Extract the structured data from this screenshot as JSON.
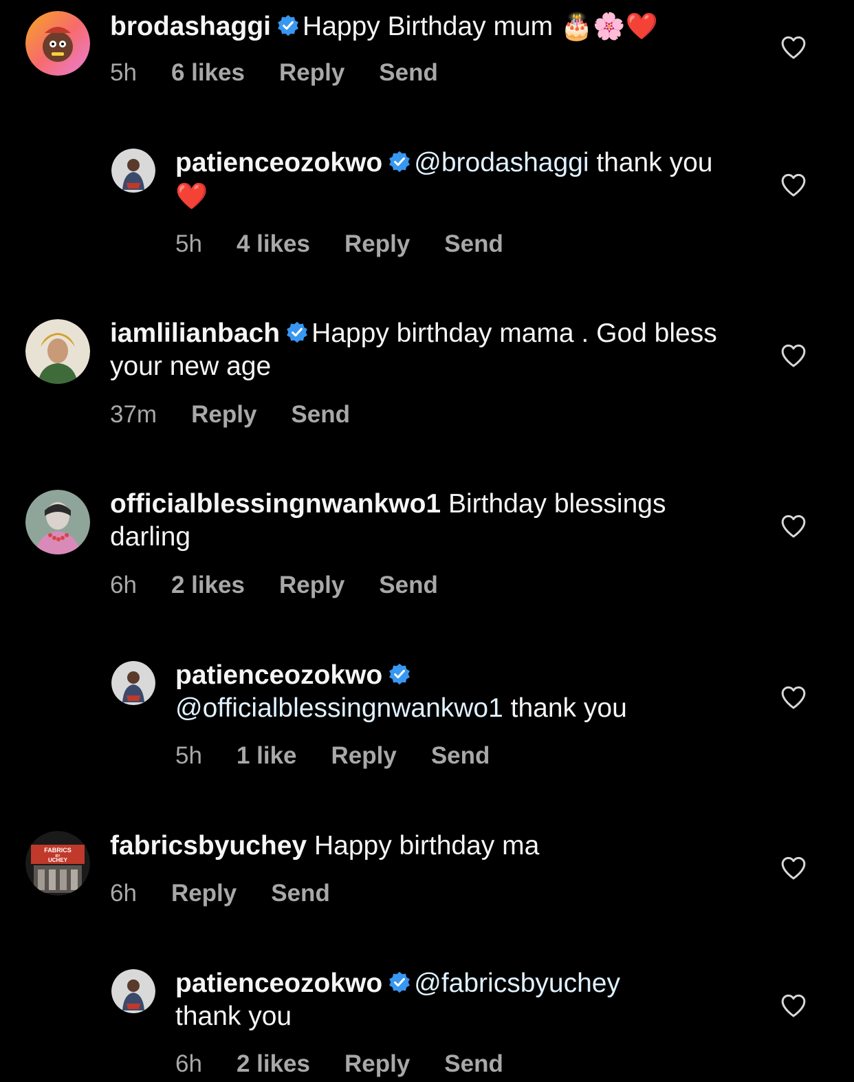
{
  "comments": [
    {
      "username": "brodashaggi",
      "verified": true,
      "text": "Happy Birthday mum",
      "emojis": [
        "🎂",
        "🌸",
        "❤️"
      ],
      "time": "5h",
      "likes": "6 likes",
      "reply": "Reply",
      "send": "Send"
    },
    {
      "username": "patienceozokwo",
      "verified": true,
      "mention": "@brodashaggi",
      "text": "thank you",
      "emojis": [
        "❤️"
      ],
      "time": "5h",
      "likes": "4 likes",
      "reply": "Reply",
      "send": "Send"
    },
    {
      "username": "iamlilianbach",
      "verified": true,
      "text": "Happy birthday mama . God bless your new age",
      "time": "37m",
      "reply": "Reply",
      "send": "Send"
    },
    {
      "username": "officialblessingnwankwo1",
      "verified": false,
      "text": "Birthday blessings darling",
      "time": "6h",
      "likes": "2 likes",
      "reply": "Reply",
      "send": "Send"
    },
    {
      "username": "patienceozokwo",
      "verified": true,
      "mention": "@officialblessingnwankwo1",
      "text": "thank you",
      "time": "5h",
      "likes": "1 like",
      "reply": "Reply",
      "send": "Send"
    },
    {
      "username": "fabricsbyuchey",
      "verified": false,
      "text": "Happy birthday ma",
      "time": "6h",
      "reply": "Reply",
      "send": "Send",
      "avatar_text": [
        "FABRICS",
        "BY",
        "UCHEY"
      ]
    },
    {
      "username": "patienceozokwo",
      "verified": true,
      "mention": "@fabricsbyuchey",
      "text": "thank you",
      "time": "6h",
      "likes": "2 likes",
      "reply": "Reply",
      "send": "Send"
    }
  ],
  "colors": {
    "background": "#000000",
    "text": "#f5f5f5",
    "meta": "#a8a8a8",
    "verified": "#3897f0",
    "mention": "#e0f1ff"
  }
}
